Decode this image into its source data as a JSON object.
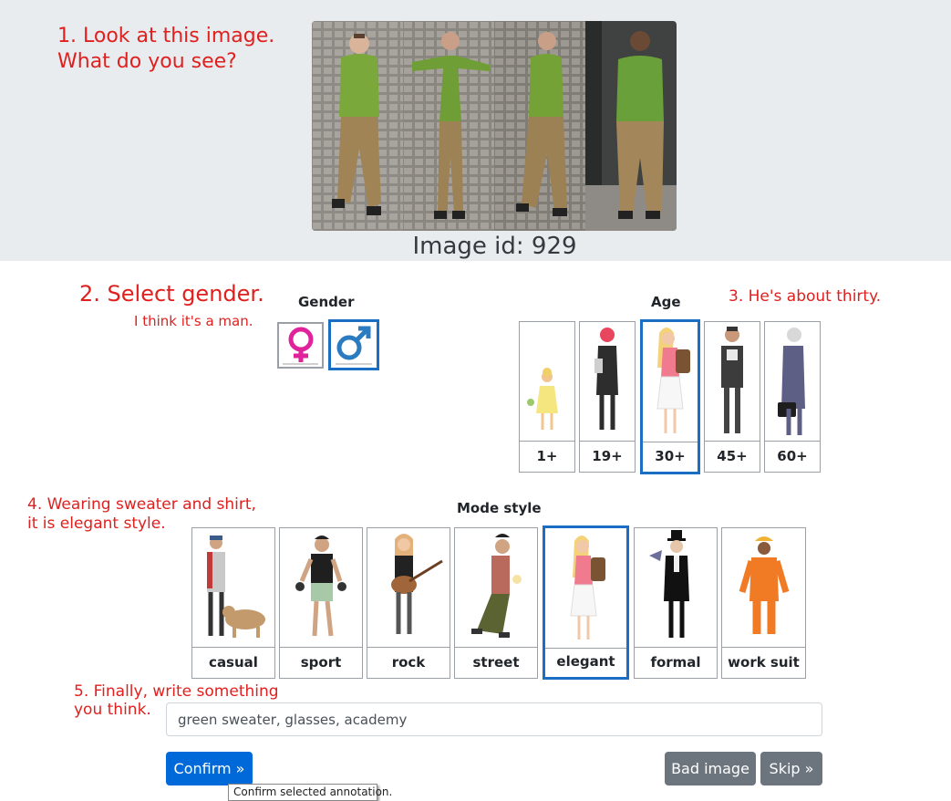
{
  "instructions": {
    "step1_line1": "1. Look at this image.",
    "step1_line2": "What do you see?",
    "step2": "2. Select gender.",
    "step2_hint": "I think it's a man.",
    "step3": "3. He's about thirty.",
    "step4_line1": "4. Wearing sweater and shirt,",
    "step4_line2": "it is elegant style.",
    "step5_line1": "5. Finally, write something",
    "step5_line2": "you think."
  },
  "image": {
    "id_text": "Image id: 929"
  },
  "gender": {
    "title": "Gender",
    "options": [
      {
        "name": "female",
        "icon": "female-symbol-icon"
      },
      {
        "name": "male",
        "icon": "male-symbol-icon"
      }
    ],
    "selected": "male",
    "colors": {
      "female": "#e0239a",
      "male": "#2a7bbf"
    }
  },
  "age": {
    "title": "Age",
    "options": [
      "1+",
      "19+",
      "30+",
      "45+",
      "60+"
    ],
    "selected": "30+"
  },
  "mode_style": {
    "title": "Mode style",
    "options": [
      "casual",
      "sport",
      "rock",
      "street",
      "elegant",
      "formal",
      "work suit"
    ],
    "selected": "elegant"
  },
  "comment": {
    "value": "green sweater, glasses, academy"
  },
  "buttons": {
    "confirm": "Confirm »",
    "bad_image": "Bad image",
    "skip": "Skip »"
  },
  "tooltip": {
    "text": "Confirm selected annotation."
  },
  "colors": {
    "accent": "#0069d9",
    "selected_border": "#1a6fc4",
    "secondary": "#6c757d",
    "note_red": "#e0201e"
  }
}
